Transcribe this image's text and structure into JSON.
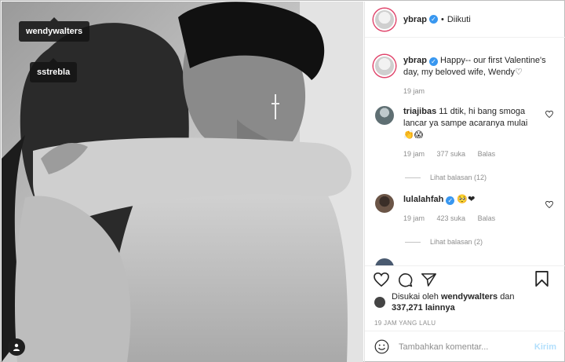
{
  "photo": {
    "tags": [
      "wendywalters",
      "sstrebla"
    ],
    "user_tag_icon": "user-icon"
  },
  "header": {
    "username": "ybrap",
    "separator": "•",
    "follow_status": "Diikuti"
  },
  "caption": {
    "username": "ybrap",
    "text": "Happy-- our first Valentine's day, my beloved wife, Wendy♡",
    "time": "19 jam"
  },
  "comments": [
    {
      "username": "triajibas",
      "text": "11 dtik, hi bang smoga lancar ya sampe acaranya mulai",
      "emoji": "👏😱",
      "time": "19 jam",
      "likes": "377 suka",
      "reply": "Balas",
      "view_replies": "Lihat balasan (12)"
    },
    {
      "username": "lulalahfah",
      "text": "",
      "emoji": "🥺❤",
      "time": "19 jam",
      "likes": "423 suka",
      "reply": "Balas",
      "view_replies": "Lihat balasan (2)"
    }
  ],
  "likes": {
    "prefix": "Disukai oleh",
    "user": "wendywalters",
    "joiner": "dan",
    "count": "337,271 lainnya"
  },
  "posted_ago": "19 JAM YANG LALU",
  "add_comment": {
    "placeholder": "Tambahkan komentar...",
    "send_label": "Kirim"
  },
  "colors": {
    "verified": "#3897f0",
    "send_disabled": "#b2dffc",
    "story_ring": "#e0446b",
    "heart_red": "#ed4956"
  }
}
